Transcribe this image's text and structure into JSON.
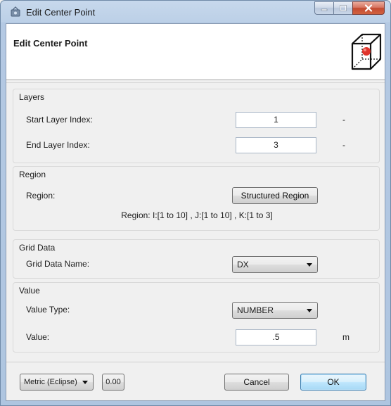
{
  "window": {
    "title": "Edit Center Point",
    "buttons": {
      "minimize": "minimize",
      "maximize": "maximize",
      "close": "close"
    }
  },
  "header": {
    "title": "Edit Center Point",
    "icon": "cube-center-point-icon"
  },
  "layers": {
    "title": "Layers",
    "start_label": "Start Layer Index:",
    "start_value": "1",
    "start_unit": "-",
    "end_label": "End Layer Index:",
    "end_value": "3",
    "end_unit": "-"
  },
  "region": {
    "title": "Region",
    "label": "Region:",
    "button_label": "Structured Region",
    "info": "Region: I:[1 to 10] , J:[1 to 10] , K:[1 to 3]"
  },
  "grid_data": {
    "title": "Grid Data",
    "label": "Grid Data Name:",
    "selected": "DX"
  },
  "value": {
    "title": "Value",
    "type_label": "Value Type:",
    "type_selected": "NUMBER",
    "value_label": "Value:",
    "value": ".5",
    "unit": "m"
  },
  "footer": {
    "units_selected": "Metric (Eclipse)",
    "precision": "0.00",
    "cancel_label": "Cancel",
    "ok_label": "OK"
  },
  "colors": {
    "accent": "#3c7fb1",
    "close_button": "#c24a31",
    "window_frame": "#b4c9e3"
  }
}
